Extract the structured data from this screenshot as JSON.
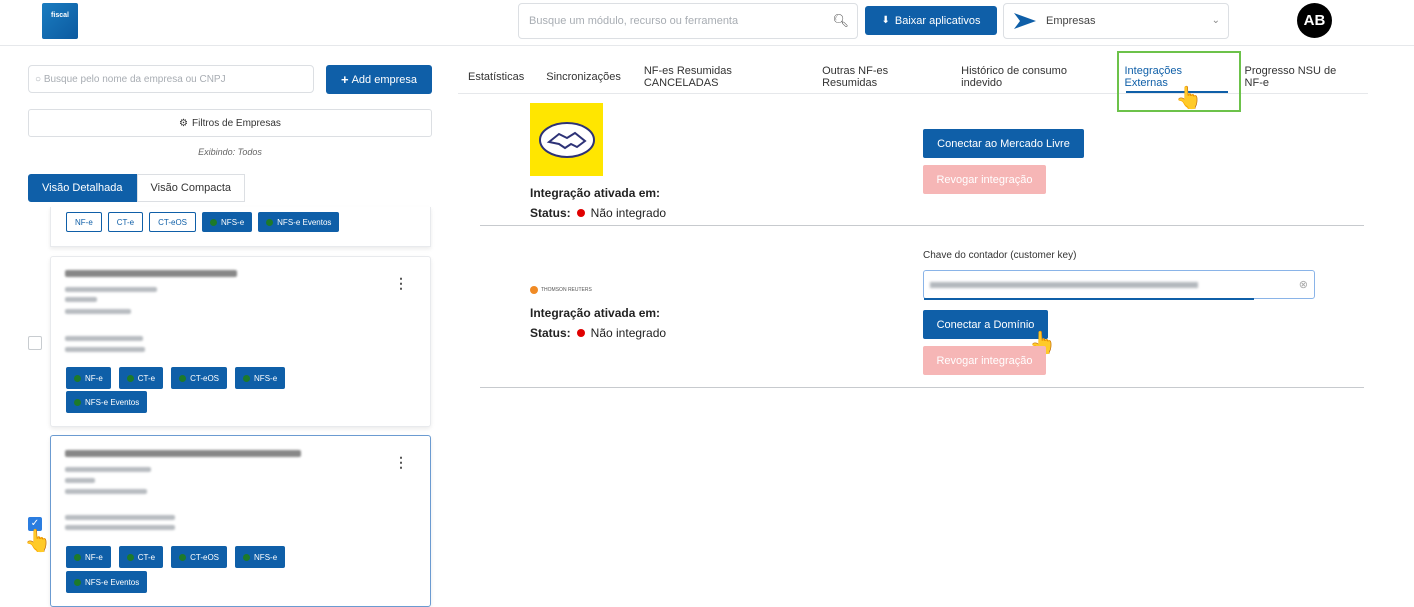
{
  "header": {
    "logo_text": "fiscal",
    "search_placeholder": "Busque um módulo, recurso ou ferramenta",
    "search_icon": "search-icon",
    "download_label": "Baixar aplicativos",
    "company_select_label": "Empresas",
    "avatar_initials": "AB"
  },
  "sidebar": {
    "search_placeholder": "Busque pelo nome da empresa ou CNPJ",
    "add_company_label": "Add empresa",
    "filters_label": "Filtros de Empresas",
    "showing_text": "Exibindo: Todos",
    "view_tabs": [
      "Visão Detalhada",
      "Visão Compacta"
    ],
    "top_card_tags": [
      "NF-e",
      "CT-e",
      "CT-eOS",
      "NFS-e",
      "NFS-e Eventos"
    ],
    "card_tags": [
      "NF-e",
      "CT-e",
      "CT-eOS",
      "NFS-e",
      "NFS-e Eventos"
    ]
  },
  "tabs": [
    "Estatísticas",
    "Sincronizações",
    "NF-es Resumidas CANCELADAS",
    "Outras NF-es Resumidas",
    "Histórico de consumo indevido",
    "Integrações Externas",
    "Progresso NSU de NF-e"
  ],
  "integrations": {
    "mercado_livre": {
      "activated_label": "Integração ativada em:",
      "status_label": "Status:",
      "status_value": "Não integrado",
      "connect_label": "Conectar ao Mercado Livre",
      "revoke_label": "Revogar integração"
    },
    "dominio": {
      "logo_text": "THOMSON REUTERS",
      "activated_label": "Integração ativada em:",
      "status_label": "Status:",
      "status_value": "Não integrado",
      "key_label": "Chave do contador (customer key)",
      "connect_label": "Conectar a Domínio",
      "revoke_label": "Revogar integração"
    }
  },
  "colors": {
    "primary": "#0f5fa8",
    "highlight": "#6cc24a",
    "status_red": "#e00000",
    "ml_yellow": "#ffe600"
  }
}
